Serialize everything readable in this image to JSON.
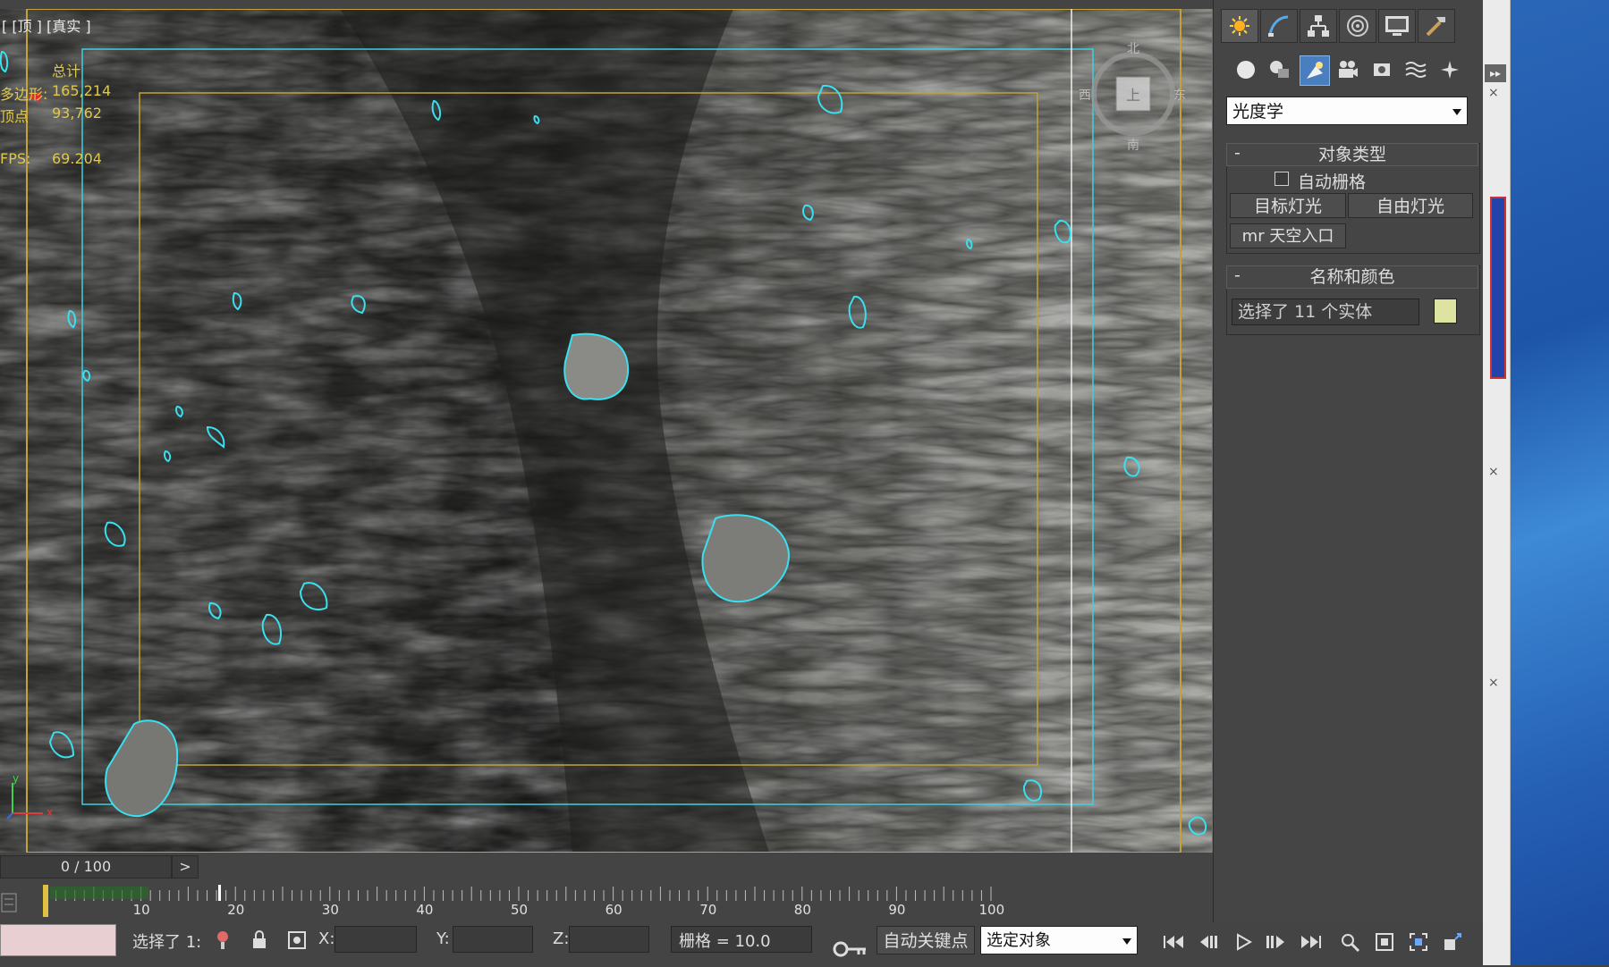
{
  "viewport": {
    "label_prefix": "[",
    "view_name": "[顶 ]",
    "shading": "[真实 ]",
    "stats": {
      "header": "总计",
      "polys_label": "多边形:",
      "polys_value": "165,214",
      "verts_label": "顶点",
      "verts_value": "93,762",
      "fps_label": "FPS:",
      "fps_value": "69.204"
    },
    "viewcube": {
      "north": "北",
      "south": "南",
      "east": "东",
      "west": "西",
      "face": "上"
    },
    "axis": {
      "x": "x",
      "y": "y"
    }
  },
  "command_panel": {
    "tabs": [
      "create-icon",
      "modify-icon",
      "hierarchy-icon",
      "motion-icon",
      "display-icon",
      "utilities-icon"
    ],
    "subtabs": [
      "geometry-icon",
      "shapes-icon",
      "lights-icon",
      "cameras-icon",
      "helpers-icon",
      "spacewarps-icon",
      "systems-icon"
    ],
    "category_dropdown": "光度学",
    "object_type": {
      "title": "对象类型",
      "collapse": "-",
      "autogrid_label": "自动栅格",
      "buttons": [
        "目标灯光",
        "自由灯光",
        "mr 天空入口"
      ]
    },
    "name_color": {
      "title": "名称和颜色",
      "collapse": "-",
      "name_value": "选择了 11 个实体",
      "swatch_color": "#dde4a2"
    }
  },
  "timeline": {
    "position": "0 / 100",
    "next_button": ">",
    "ticks": [
      "10",
      "20",
      "30",
      "40",
      "50",
      "60",
      "70",
      "80",
      "90",
      "100"
    ]
  },
  "statusbar": {
    "selection_text": "选择了 1:",
    "x_label": "X:",
    "y_label": "Y:",
    "z_label": "Z:",
    "grid_text": "栅格 = 10.0",
    "autokey_label": "自动关键点",
    "key_filter_dropdown": "选定对象"
  }
}
